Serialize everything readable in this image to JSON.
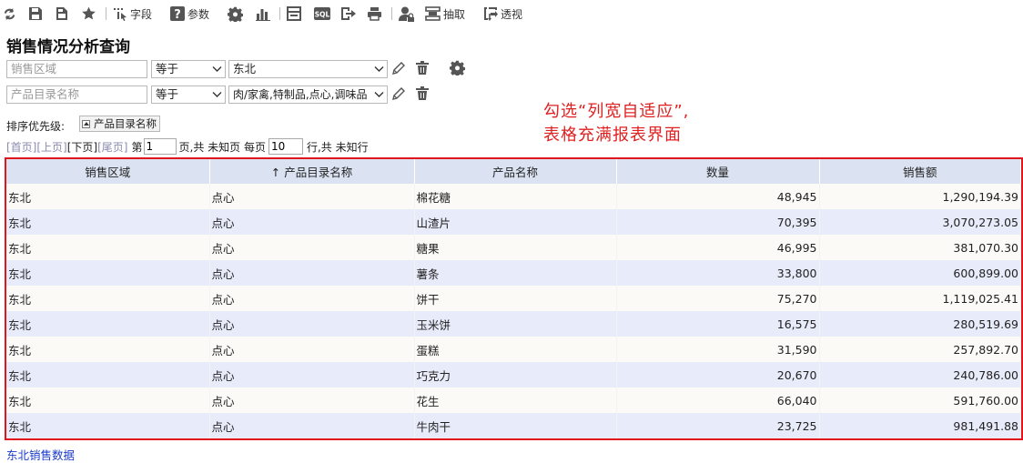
{
  "toolbar": {
    "fields_label": "字段",
    "params_label": "参数",
    "extract_label": "抽取",
    "pivot_label": "透视"
  },
  "report_title": "销售情况分析查询",
  "filters": [
    {
      "field_placeholder": "销售区域",
      "operator": "等于",
      "value": "东北"
    },
    {
      "field_placeholder": "产品目录名称",
      "operator": "等于",
      "value": "肉/家禽,特制品,点心,调味品"
    }
  ],
  "sort": {
    "label": "排序优先级:",
    "chip_label": "产品目录名称"
  },
  "pager": {
    "first": "[首页]",
    "prev": "[上页]",
    "next": "[下页]",
    "last": "[尾页]",
    "page_prefix": "第",
    "page_value": "1",
    "page_suffix": "页,共 未知页 每页",
    "rows_value": "10",
    "rows_suffix": "行,共 未知行"
  },
  "annotation": {
    "line1": "勾选“列宽自适应”,",
    "line2": "表格充满报表界面"
  },
  "table": {
    "columns": [
      "销售区域",
      "产品目录名称",
      "产品名称",
      "数量",
      "销售额"
    ],
    "sort_indicator": "↑",
    "rows": [
      [
        "东北",
        "点心",
        "棉花糖",
        "48,945",
        "1,290,194.39"
      ],
      [
        "东北",
        "点心",
        "山渣片",
        "70,395",
        "3,070,273.05"
      ],
      [
        "东北",
        "点心",
        "糖果",
        "46,995",
        "381,070.30"
      ],
      [
        "东北",
        "点心",
        "薯条",
        "33,800",
        "600,899.00"
      ],
      [
        "东北",
        "点心",
        "饼干",
        "75,270",
        "1,119,025.41"
      ],
      [
        "东北",
        "点心",
        "玉米饼",
        "16,575",
        "280,519.69"
      ],
      [
        "东北",
        "点心",
        "蛋糕",
        "31,590",
        "257,892.70"
      ],
      [
        "东北",
        "点心",
        "巧克力",
        "20,670",
        "240,786.00"
      ],
      [
        "东北",
        "点心",
        "花生",
        "66,040",
        "591,760.00"
      ],
      [
        "东北",
        "点心",
        "牛肉干",
        "23,725",
        "981,491.88"
      ]
    ]
  },
  "footer_link": "东北销售数据",
  "colors": {
    "header_bg": "#dbe3f2",
    "row_odd": "#fbfaf7",
    "row_even": "#e8ebfa",
    "highlight_border": "#e0161c",
    "annotation": "#e02020",
    "link": "#1a3acc"
  }
}
